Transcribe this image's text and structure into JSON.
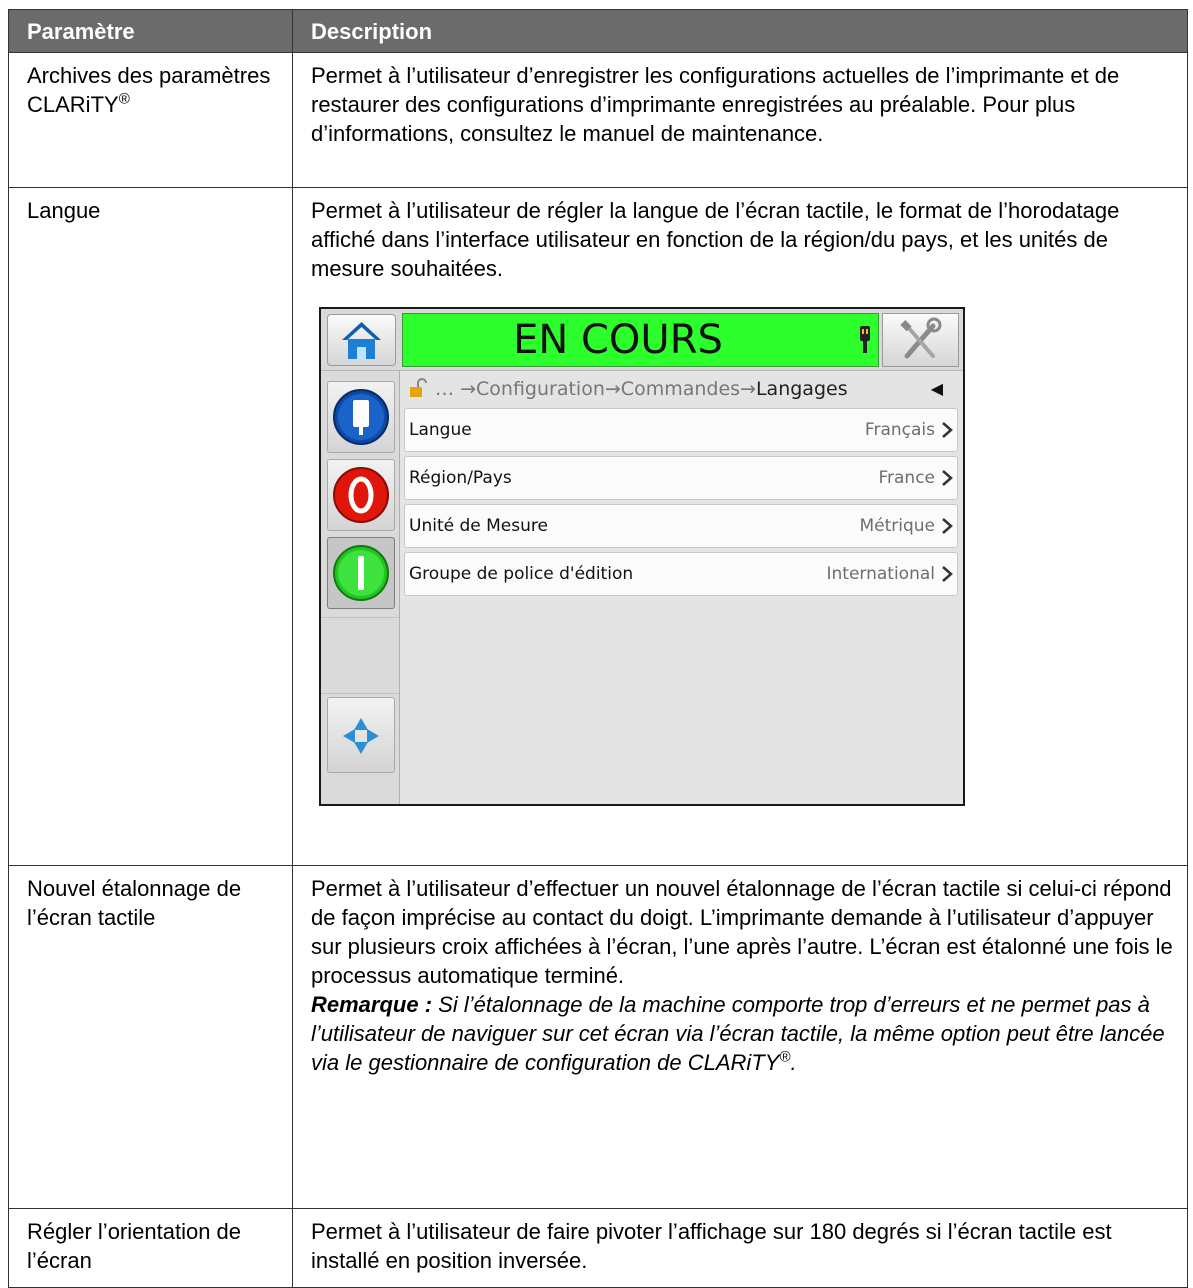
{
  "table": {
    "col1_header": "Paramètre",
    "col2_header": "Description",
    "rows": [
      {
        "param_main": "Archives des paramètres CLARiTY",
        "param_sup": "®",
        "description": "Permet à l’utilisateur d’enregistrer les configurations actuelles de l’imprimante et de restaurer des configurations d’imprimante enregistrées au préalable. Pour plus d’informations, consultez le manuel de maintenance."
      },
      {
        "param": "Langue",
        "description": "Permet à l’utilisateur de régler la langue de l’écran tactile, le format de l’horodatage affiché dans l’interface utilisateur en fonction de la région/du pays, et les unités de mesure souhaitées."
      },
      {
        "param": "Nouvel étalonnage de l’écran tactile",
        "description": "Permet à l’utilisateur d’effectuer un nouvel étalonnage de l’écran tactile si celui-ci répond de façon imprécise au contact du doigt. L’imprimante demande à l’utilisateur d’appuyer sur plusieurs croix affichées à l’écran, l’une après l’autre. L’écran est étalonné une fois le processus automatique terminé.",
        "note_label": "Remarque :",
        "note_text": " Si l’étalonnage de la machine comporte trop d’erreurs et ne permet pas à l’utilisateur de naviguer sur cet écran via l’écran tactile, la même option peut être lancée via le gestionnaire de configuration de CLARiTY",
        "note_sup": "®",
        "note_end": "."
      },
      {
        "param": "Régler l’orientation de l’écran",
        "description": "Permet à l’utilisateur de faire pivoter l’affichage sur 180 degrés si l’écran tactile est installé en position inversée."
      }
    ]
  },
  "screen": {
    "status_text": "EN COURS",
    "status_color": "#2cff2c",
    "breadcrumb_prefix": "…",
    "breadcrumb_items": [
      "Configuration",
      "Commandes"
    ],
    "breadcrumb_current": "Langages",
    "breadcrumb_arrow": "→",
    "back_glyph": "◀",
    "settings": [
      {
        "label": "Langue",
        "value": "Français"
      },
      {
        "label": "Région/Pays",
        "value": "France"
      },
      {
        "label": "Unité de Mesure",
        "value": "Métrique"
      },
      {
        "label": "Groupe de police d'édition",
        "value": "International"
      }
    ],
    "icons": {
      "home": "home-icon",
      "tools": "tools-icon",
      "ink": "ink-bottle-icon",
      "stop": "stop-icon",
      "start": "start-icon",
      "nav": "navigation-arrows-icon"
    }
  }
}
